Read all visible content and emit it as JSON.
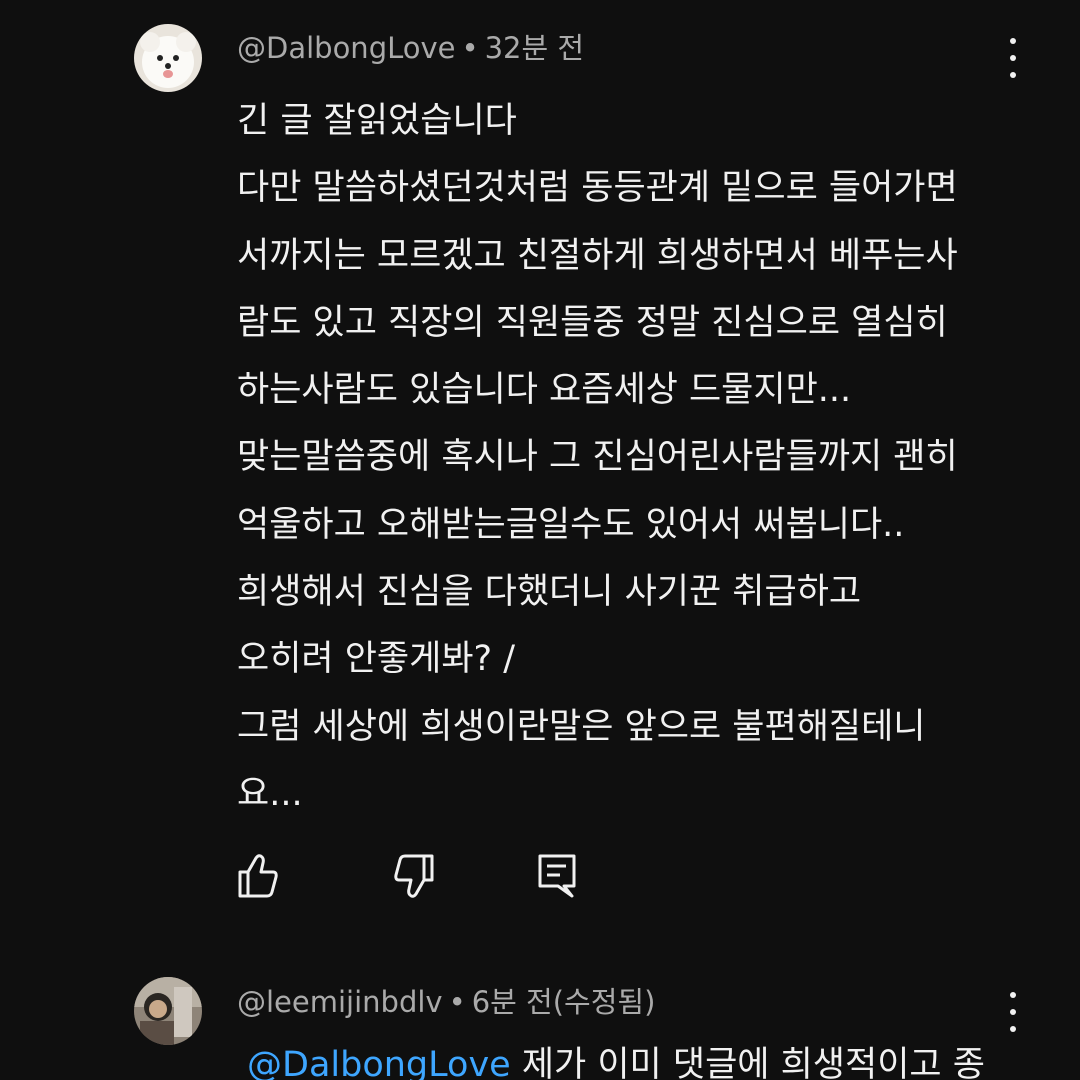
{
  "comments": [
    {
      "author": "@DalbongLove",
      "separator": "•",
      "time": "32분 전",
      "lines": [
        "긴 글 잘읽었습니다",
        "다만 말씀하셨던것처럼 동등관계 밑으로 들어가면",
        "서까지는 모르겠고 친절하게 희생하면서 베푸는사",
        "람도 있고 직장의 직원들중 정말 진심으로 열심히",
        "하는사람도 있습니다 요즘세상 드물지만...",
        "맞는말씀중에 혹시나 그 진심어린사람들까지 괜히",
        "억울하고 오해받는글일수도 있어서 써봅니다..",
        "희생해서 진심을 다했더니 사기꾼 취급하고",
        "오히려 안좋게봐? /",
        "그럼 세상에 희생이란말은 앞으로 불편해질테니",
        "요..."
      ],
      "actions": {
        "like_icon": "thumbs-up-icon",
        "dislike_icon": "thumbs-down-icon",
        "reply_icon": "reply-icon"
      }
    },
    {
      "author": "@leemijinbdlv",
      "separator": "•",
      "time": "6분 전(수정됨)",
      "mention": "@DalbongLove",
      "text": " 제가 이미 댓글에 희생적이고 종"
    }
  ],
  "colors": {
    "background": "#0f0f0f",
    "text_primary": "#f1f1f1",
    "text_secondary": "#aaaaaa",
    "mention": "#3ea6ff"
  }
}
